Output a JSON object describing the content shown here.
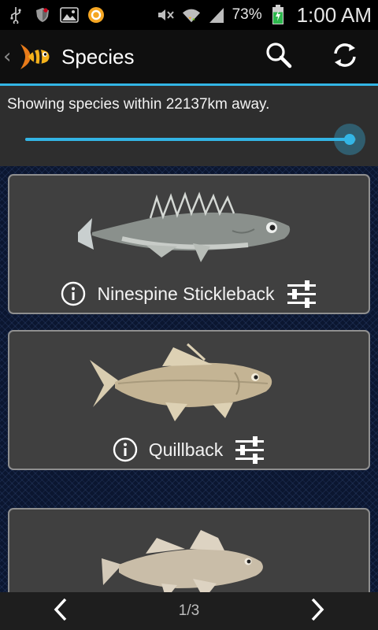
{
  "status_bar": {
    "left_icons": [
      "usb-icon",
      "shield-icon",
      "image-icon",
      "circle-app-icon"
    ],
    "right_icons": [
      "mute-icon",
      "wifi-icon",
      "signal-icon"
    ],
    "battery_percent": "73%",
    "time": "1:00 AM",
    "battery_level": 0.73
  },
  "action_bar": {
    "title": "Species",
    "actions": [
      "search-icon",
      "refresh-icon"
    ]
  },
  "distance": {
    "label": "Showing species within 22137km away.",
    "slider_value": 0.98
  },
  "species": [
    {
      "name": "Ninespine Stickleback"
    },
    {
      "name": "Quillback"
    },
    {
      "name": ""
    }
  ],
  "pagination": {
    "indicator": "1/3"
  },
  "colors": {
    "accent": "#33b5e5",
    "card_bg": "#404040",
    "card_border": "#8f8f8f",
    "background": "#0b1630"
  }
}
